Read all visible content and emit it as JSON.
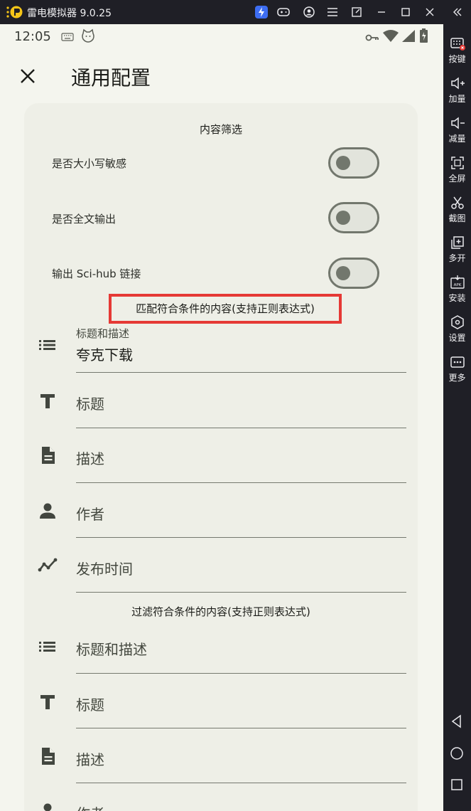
{
  "emulator": {
    "app_name": "雷电模拟器 9.0.25",
    "titlebar_icons": [
      "bolt-icon",
      "gamepad-icon",
      "account-icon",
      "menu-icon",
      "popout-icon",
      "minimize-icon",
      "maximize-icon",
      "close-icon",
      "collapse-icon"
    ],
    "sidebar": [
      {
        "icon": "keyboard-icon",
        "label": "按键"
      },
      {
        "icon": "volume-up-icon",
        "label": "加量"
      },
      {
        "icon": "volume-down-icon",
        "label": "减量"
      },
      {
        "icon": "fullscreen-icon",
        "label": "全屏"
      },
      {
        "icon": "scissors-icon",
        "label": "截图"
      },
      {
        "icon": "multi-instance-icon",
        "label": "多开"
      },
      {
        "icon": "apk-icon",
        "label": "安装"
      },
      {
        "icon": "settings-icon",
        "label": "设置"
      },
      {
        "icon": "more-icon",
        "label": "更多"
      }
    ],
    "nav": [
      "back-icon",
      "home-icon",
      "recents-icon"
    ]
  },
  "status_bar": {
    "time": "12:05"
  },
  "app_bar": {
    "title": "通用配置"
  },
  "content_filter": {
    "title": "内容筛选",
    "toggles": [
      {
        "label": "是否大小写敏感",
        "on": false
      },
      {
        "label": "是否全文输出",
        "on": false
      },
      {
        "label": "输出 Sci-hub 链接",
        "on": false
      }
    ]
  },
  "match_section": {
    "title": "匹配符合条件的内容(支持正则表达式)",
    "fields": [
      {
        "icon": "list-icon",
        "label": "标题和描述",
        "value": "夸克下载"
      },
      {
        "icon": "text-icon",
        "label": "标题",
        "value": ""
      },
      {
        "icon": "document-icon",
        "label": "描述",
        "value": ""
      },
      {
        "icon": "person-icon",
        "label": "作者",
        "value": ""
      },
      {
        "icon": "timeline-icon",
        "label": "发布时间",
        "value": ""
      }
    ]
  },
  "filter_section": {
    "title": "过滤符合条件的内容(支持正则表达式)",
    "fields": [
      {
        "icon": "list-icon",
        "label": "标题和描述",
        "value": ""
      },
      {
        "icon": "text-icon",
        "label": "标题",
        "value": ""
      },
      {
        "icon": "document-icon",
        "label": "描述",
        "value": ""
      },
      {
        "icon": "person-icon",
        "label": "作者",
        "value": ""
      }
    ]
  },
  "colors": {
    "highlight": "#e53935",
    "background": "#f4f5ee",
    "card": "#eeefe7",
    "emulator_chrome": "#1f1f26"
  }
}
